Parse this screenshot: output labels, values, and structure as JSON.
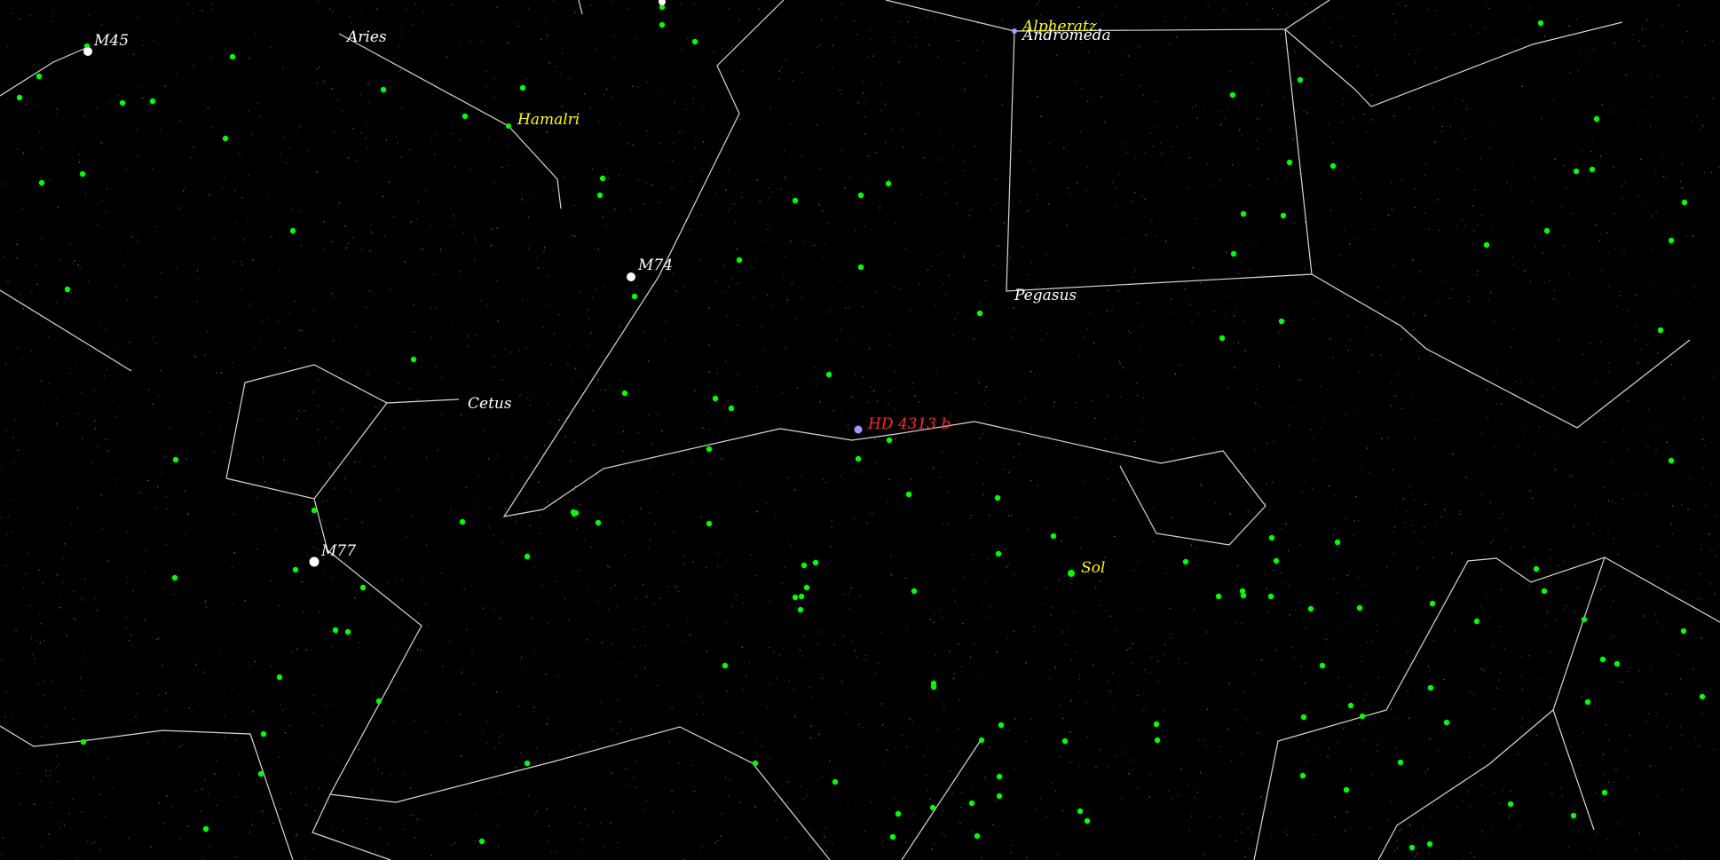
{
  "view": {
    "background": "#000000",
    "colors": {
      "constellation_line": "#d8d8d8",
      "constellation_label": "#ffffff",
      "star_label": "#ffff00",
      "target_label": "#ff2a2a",
      "exoplanet_host": "#00ff00",
      "messier": "#ffffff",
      "target_marker": "#9999ff"
    }
  },
  "labels": {
    "constellations": {
      "aries": "Aries",
      "andromeda": "Andromeda",
      "pegasus": "Pegasus",
      "cetus": "Cetus"
    },
    "stars": {
      "alpheratz": "Alpheratz",
      "hamalri": "Hamalri",
      "sol": "Sol"
    },
    "messier": {
      "m45": "M45",
      "m74": "M74",
      "m77": "M77"
    },
    "target": {
      "hd4313b": "HD 4313 b"
    }
  }
}
